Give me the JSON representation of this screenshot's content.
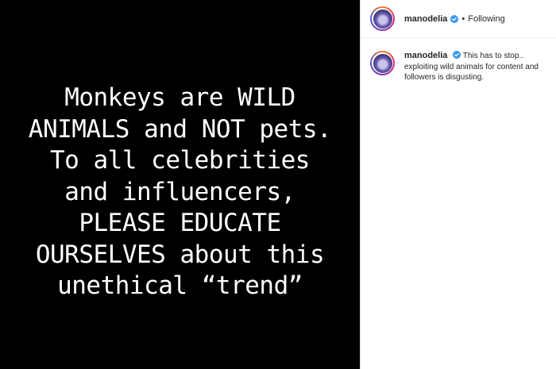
{
  "media": {
    "lines": [
      "Monkeys are WILD",
      "ANIMALS and NOT pets.",
      "To all celebrities",
      "and influencers,",
      "PLEASE EDUCATE",
      "OURSELVES about this",
      "unethical “trend”"
    ],
    "background": "#000000",
    "text_color": "#ffffff"
  },
  "header": {
    "username": "manodelia",
    "separator": "•",
    "follow_status": "Following",
    "verified_icon": "verified-badge-icon"
  },
  "comment": {
    "username": "manodelia",
    "text": "This has to stop.. exploiting wild animals for content and followers is disgusting."
  },
  "colors": {
    "verified_blue": "#3897f0",
    "text": "#262626",
    "border": "#dbdbdb"
  }
}
